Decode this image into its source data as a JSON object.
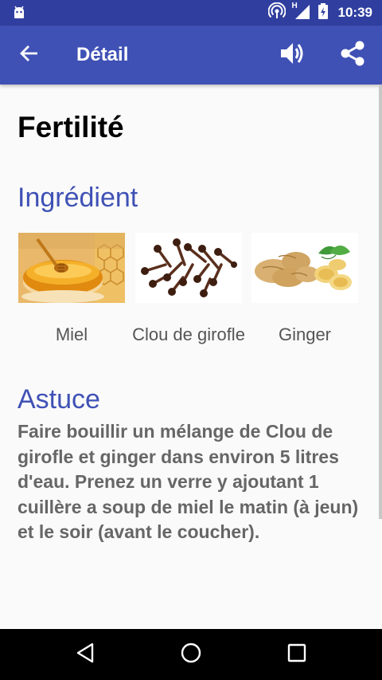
{
  "status_bar": {
    "time": "10:39",
    "network": "H",
    "icons": [
      "android-icon",
      "hotspot-icon",
      "signal-icon",
      "battery-icon"
    ]
  },
  "app_bar": {
    "title": "Détail",
    "back_icon": "arrow-left-icon",
    "sound_icon": "volume-icon",
    "share_icon": "share-icon",
    "color": "#3f51b5",
    "status_color": "#303f9f"
  },
  "recipe": {
    "title": "Fertilité",
    "ingredients_heading": "Ingrédient",
    "ingredients": [
      {
        "name": "Miel"
      },
      {
        "name": "Clou de girofle"
      },
      {
        "name": "Ginger"
      }
    ],
    "tip_heading": "Astuce",
    "tip_text": "Faire bouillir un mélange de Clou de girofle et ginger dans environ 5 litres d'eau. Prenez un verre y ajoutant 1 cuillère a soup de miel le matin (à jeun) et le soir (avant le coucher)."
  },
  "nav_bar": {
    "icons": [
      "nav-back-icon",
      "nav-home-icon",
      "nav-recents-icon"
    ]
  }
}
